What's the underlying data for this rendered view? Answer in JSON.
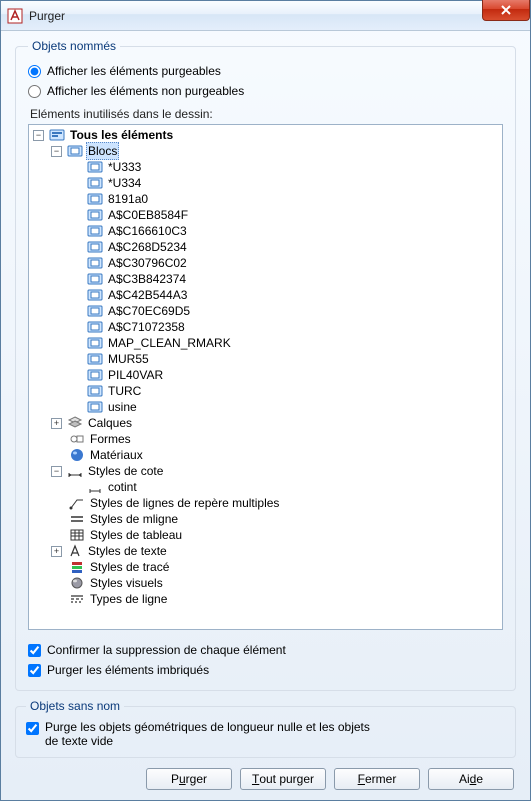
{
  "title": "Purger",
  "group_named": "Objets nommés",
  "radio_purgeable": "Afficher les éléments purgeables",
  "radio_non_purgeable": "Afficher les éléments non purgeables",
  "unused_label": "Eléments inutilisés dans le dessin:",
  "tree": {
    "root": "Tous les éléments",
    "blocks": {
      "label": "Blocs",
      "items": [
        "*U333",
        "*U334",
        "8191a0",
        "A$C0EB8584F",
        "A$C166610C3",
        "A$C268D5234",
        "A$C30796C02",
        "A$C3B842374",
        "A$C42B544A3",
        "A$C70EC69D5",
        "A$C71072358",
        "MAP_CLEAN_RMARK",
        "MUR55",
        "PIL40VAR",
        "TURC",
        "usine"
      ]
    },
    "layers": "Calques",
    "shapes": "Formes",
    "materials": "Matériaux",
    "dimstyles": {
      "label": "Styles de cote",
      "items": [
        "cotint"
      ]
    },
    "mleader": "Styles de lignes de repère multiples",
    "mline": "Styles de mligne",
    "tablestyle": "Styles de tableau",
    "textstyle": "Styles de texte",
    "plotstyle": "Styles de tracé",
    "visualstyle": "Styles visuels",
    "linetype": "Types de ligne"
  },
  "confirm_each": "Confirmer la suppression de chaque élément",
  "purge_nested": "Purger les éléments imbriqués",
  "group_unnamed": "Objets sans nom",
  "purge_zero": "Purge les objets géométriques de longueur nulle et les objets de texte vide",
  "buttons": {
    "purge_pre": "P",
    "purge_u": "u",
    "purge_post": "rger",
    "purgeall_pre": "",
    "purgeall_u": "T",
    "purgeall_post": "out purger",
    "close_pre": "",
    "close_u": "F",
    "close_post": "ermer",
    "help_pre": "Ai",
    "help_u": "d",
    "help_post": "e"
  }
}
